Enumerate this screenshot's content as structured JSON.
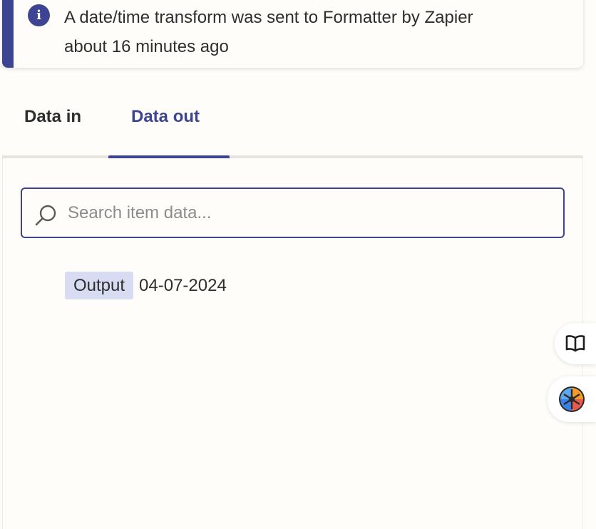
{
  "notice": {
    "line1": "A date/time transform was sent to Formatter by Zapier",
    "line2": "about 16 minutes ago",
    "icon": "info-icon"
  },
  "tabs": [
    {
      "label": "Data in",
      "active": false
    },
    {
      "label": "Data out",
      "active": true
    }
  ],
  "search": {
    "placeholder": "Search item data...",
    "value": "",
    "icon": "search-icon"
  },
  "output": {
    "key": "Output",
    "value": "04-07-2024"
  },
  "side_buttons": [
    {
      "icon": "book-icon"
    },
    {
      "icon": "ai-copilot-icon"
    }
  ],
  "colors": {
    "accent": "#3d4592",
    "key_chip": "#d7dcf3",
    "background": "#fffdf9"
  }
}
